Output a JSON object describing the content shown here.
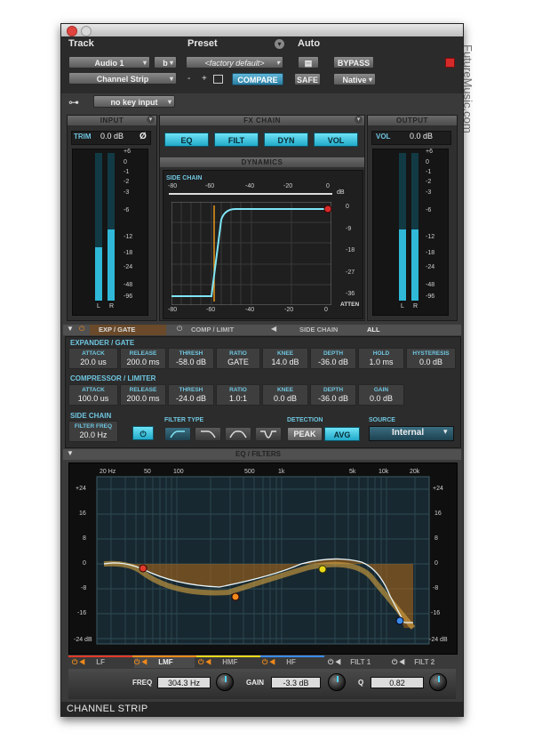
{
  "watermark": "FutureMusic.com",
  "header": {
    "track_label": "Track",
    "preset_label": "Preset",
    "auto_label": "Auto",
    "track_name": "Audio 1",
    "track_channel": "b",
    "plugin_name": "Channel Strip",
    "preset_name": "<factory default>",
    "minus": "-",
    "plus": "+",
    "compare": "COMPARE",
    "safe": "SAFE",
    "bypass": "BYPASS",
    "native": "Native",
    "key_input": "no key input"
  },
  "input": {
    "title": "INPUT",
    "trim_label": "TRIM",
    "trim_value": "0.0 dB",
    "phase": "Ø",
    "left": "L",
    "right": "R",
    "level_left": 0.36,
    "level_right": 0.48
  },
  "meter_scale": [
    "+6",
    "0",
    "-1",
    "-2",
    "-3",
    "-6",
    "-12",
    "-18",
    "-24",
    "-48",
    "-96"
  ],
  "fx_chain": {
    "title": "FX CHAIN",
    "modules": [
      "EQ",
      "FILT",
      "DYN",
      "VOL"
    ],
    "dynamics_title": "DYNAMICS",
    "side_chain_label": "SIDE CHAIN",
    "sc_scale": [
      "-80",
      "-60",
      "-40",
      "-20",
      "0"
    ],
    "sc_db": "dB",
    "atten_scale": [
      "0",
      "-9",
      "-18",
      "-27",
      "-36"
    ],
    "atten_label": "ATTEN",
    "bottom_scale": [
      "-80",
      "-60",
      "-40",
      "-20",
      "0"
    ]
  },
  "output": {
    "title": "OUTPUT",
    "vol_label": "VOL",
    "vol_value": "0.0 dB",
    "left": "L",
    "right": "R",
    "level_left": 0.48,
    "level_right": 0.48
  },
  "dyn_tabs": {
    "exp_gate": "EXP / GATE",
    "comp_limit": "COMP / LIMIT",
    "side_chain": "SIDE CHAIN",
    "all": "ALL"
  },
  "expander": {
    "title": "EXPANDER / GATE",
    "params": [
      {
        "label": "ATTACK",
        "value": "20.0 us"
      },
      {
        "label": "RELEASE",
        "value": "200.0 ms"
      },
      {
        "label": "THRESH",
        "value": "-58.0 dB"
      },
      {
        "label": "RATIO",
        "value": "GATE"
      },
      {
        "label": "KNEE",
        "value": "14.0 dB"
      },
      {
        "label": "DEPTH",
        "value": "-36.0 dB"
      },
      {
        "label": "HOLD",
        "value": "1.0 ms"
      },
      {
        "label": "HYSTERESIS",
        "value": "0.0 dB"
      }
    ]
  },
  "compressor": {
    "title": "COMPRESSOR / LIMITER",
    "params": [
      {
        "label": "ATTACK",
        "value": "100.0 us"
      },
      {
        "label": "RELEASE",
        "value": "200.0 ms"
      },
      {
        "label": "THRESH",
        "value": "-24.0 dB"
      },
      {
        "label": "RATIO",
        "value": "1.0:1"
      },
      {
        "label": "KNEE",
        "value": "0.0 dB"
      },
      {
        "label": "DEPTH",
        "value": "-36.0 dB"
      },
      {
        "label": "GAIN",
        "value": "0.0 dB"
      }
    ]
  },
  "sidechain": {
    "title": "SIDE CHAIN",
    "filter_freq_label": "FILTER FREQ",
    "filter_freq_value": "20.0 Hz",
    "filter_type_label": "FILTER TYPE",
    "detection_label": "DETECTION",
    "peak": "PEAK",
    "avg": "AVG",
    "source_label": "SOURCE",
    "source_value": "Internal"
  },
  "eq": {
    "title": "EQ / FILTERS",
    "freq_labels": [
      "20 Hz",
      "50",
      "100",
      "500",
      "1k",
      "5k",
      "10k",
      "20k"
    ],
    "db_labels": [
      "+24",
      "16",
      "8",
      "0",
      "-8",
      "-16",
      "-24 dB"
    ],
    "bands": [
      "LF",
      "LMF",
      "HMF",
      "HF",
      "FILT 1",
      "FILT 2"
    ],
    "freq_label": "FREQ",
    "freq_value": "304.3 Hz",
    "gain_label": "GAIN",
    "gain_value": "-3.3 dB",
    "q_label": "Q",
    "q_value": "0.82"
  },
  "footer": {
    "title": "CHANNEL STRIP"
  },
  "colors": {
    "accent": "#2fb8d8",
    "lf": "#e03a2a",
    "lmf": "#f08a1a",
    "hmf": "#e8d81a",
    "hf": "#3a8ae8"
  }
}
